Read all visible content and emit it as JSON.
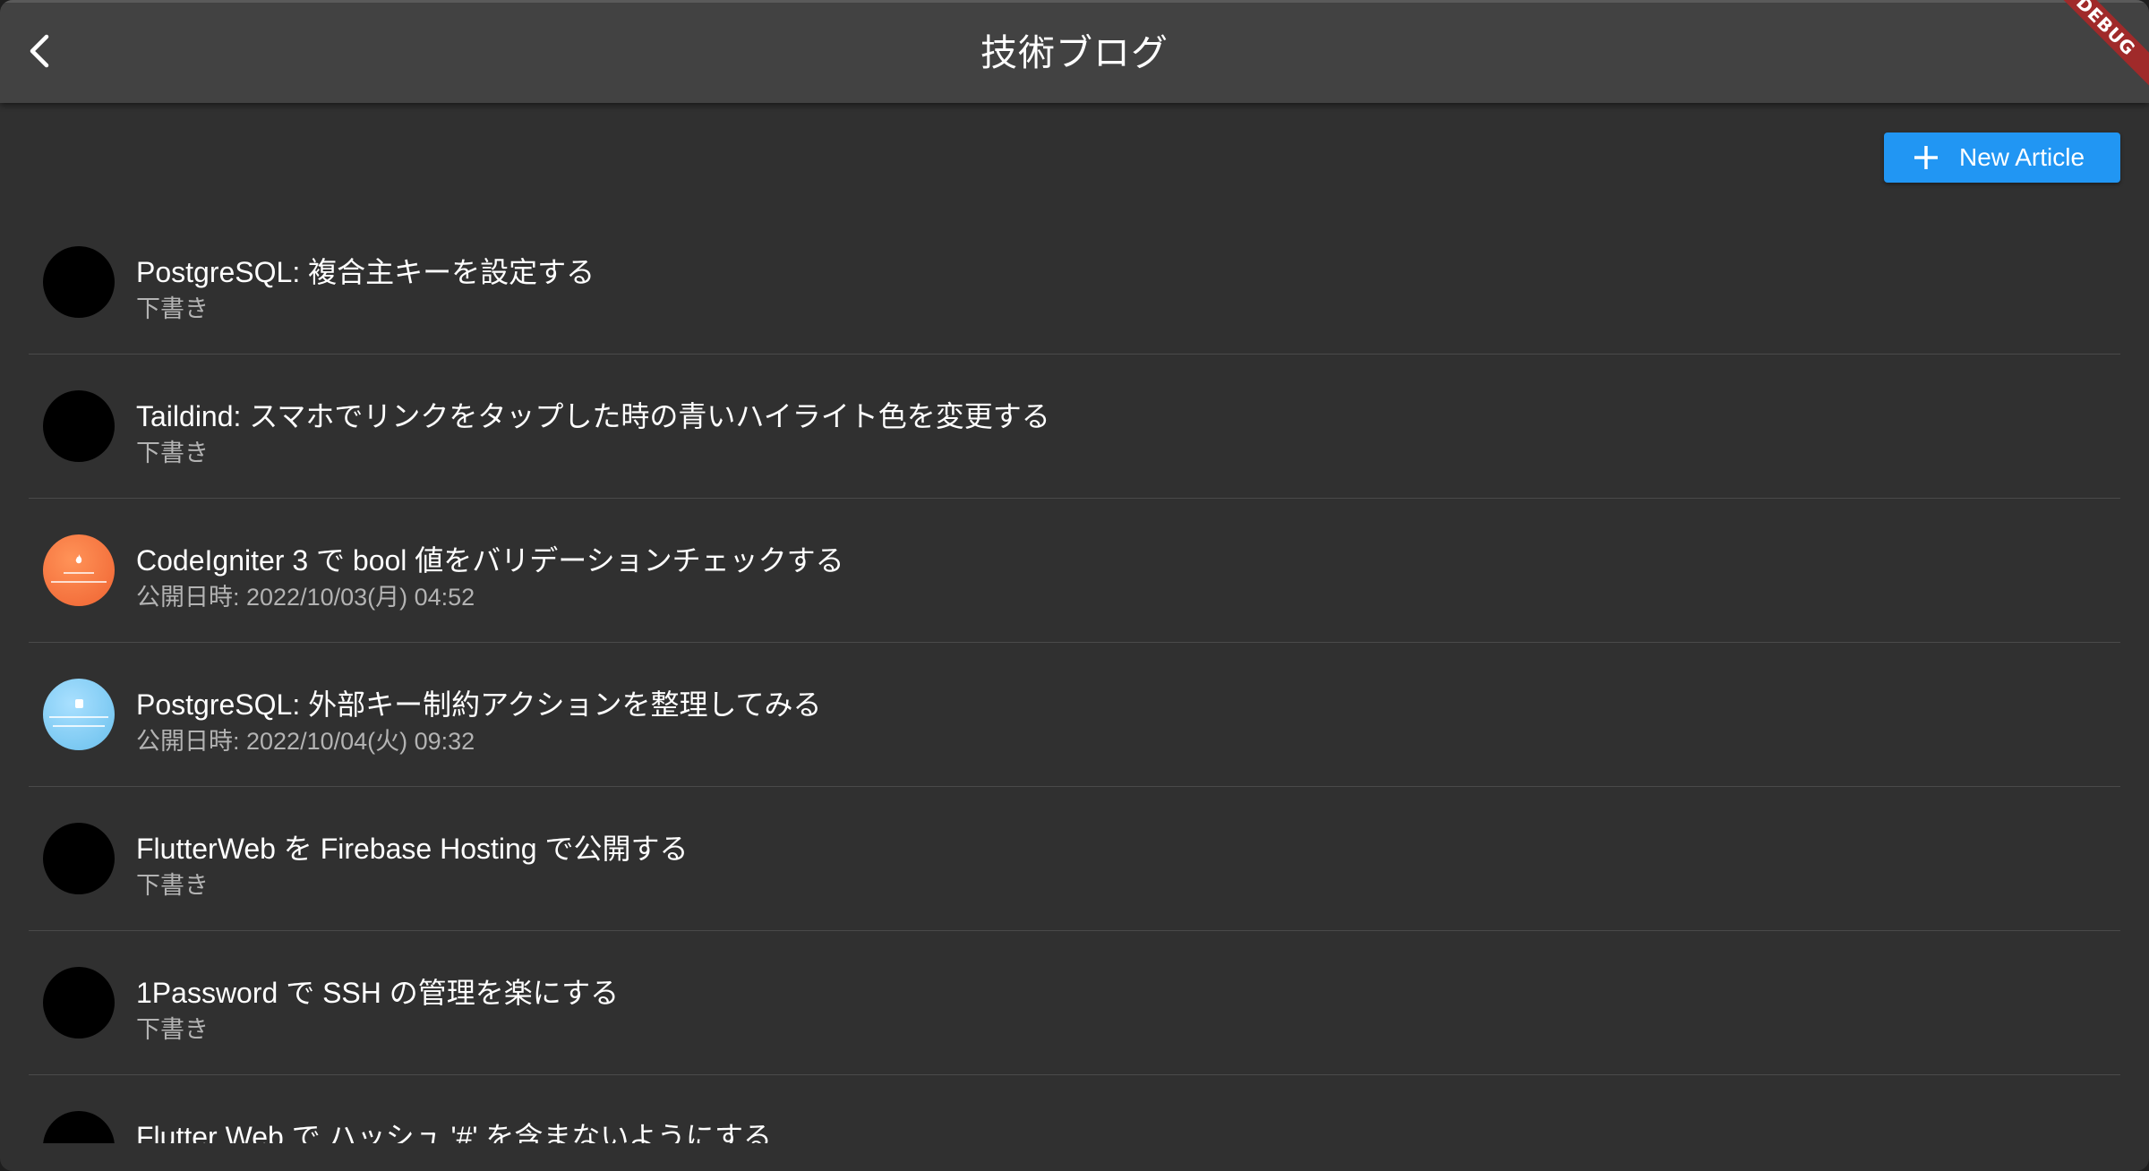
{
  "appbar": {
    "title": "技術ブログ",
    "back_icon": "chevron-left-icon"
  },
  "debug_banner": {
    "label": "DEBUG"
  },
  "new_article_button": {
    "label": "New Article",
    "icon": "plus-icon",
    "color": "#2196f3"
  },
  "articles": [
    {
      "title": "PostgreSQL: 複合主キーを設定する",
      "subtitle": "下書き",
      "avatar": "black"
    },
    {
      "title": "Taildind: スマホでリンクをタップした時の青いハイライト色を変更する",
      "subtitle": "下書き",
      "avatar": "black"
    },
    {
      "title": "CodeIgniter 3 で bool 値をバリデーションチェックする",
      "subtitle": "公開日時: 2022/10/03(月) 04:52",
      "avatar": "orange"
    },
    {
      "title": "PostgreSQL: 外部キー制約アクションを整理してみる",
      "subtitle": "公開日時: 2022/10/04(火) 09:32",
      "avatar": "blue"
    },
    {
      "title": "FlutterWeb を Firebase Hosting で公開する",
      "subtitle": "下書き",
      "avatar": "black"
    },
    {
      "title": "1Password で SSH の管理を楽にする",
      "subtitle": "下書き",
      "avatar": "black"
    },
    {
      "title": "Flutter Web で ハッシュ '#' を含まないようにする",
      "subtitle": "",
      "avatar": "black"
    }
  ]
}
